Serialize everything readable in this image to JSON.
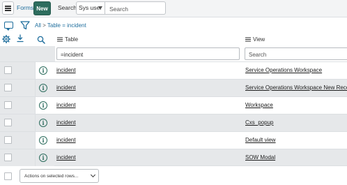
{
  "header": {
    "title": "Forms",
    "new_label": "New",
    "search_label": "Search",
    "search_field": "Sys user",
    "search_placeholder": "Search"
  },
  "breadcrumb": {
    "all": "All",
    "separator": ">",
    "filter": "Table = incident"
  },
  "columns": {
    "table": "Table",
    "view": "View"
  },
  "filters": {
    "table_value": "=incident",
    "view_placeholder": "Search"
  },
  "rows": [
    {
      "table": "incident",
      "view": "Service Operations Workspace"
    },
    {
      "table": "incident",
      "view": "Service Operations Workspace New Record"
    },
    {
      "table": "incident",
      "view": "Workspace"
    },
    {
      "table": "incident",
      "view": "Cxs_popup"
    },
    {
      "table": "incident",
      "view": "Default view"
    },
    {
      "table": "incident",
      "view": "SOW Modal"
    }
  ],
  "footer": {
    "actions_label": "Actions on selected rows..."
  },
  "colors": {
    "accent": "#2d6d5e",
    "link": "#1f6e9d",
    "row_alt": "#e6e8ea"
  },
  "icons": {
    "menu": "hamburger-icon",
    "chat": "chat-icon",
    "filter": "funnel-icon",
    "settings": "gear-icon",
    "export": "download-icon",
    "search": "magnifier-icon",
    "info": "info-icon"
  }
}
